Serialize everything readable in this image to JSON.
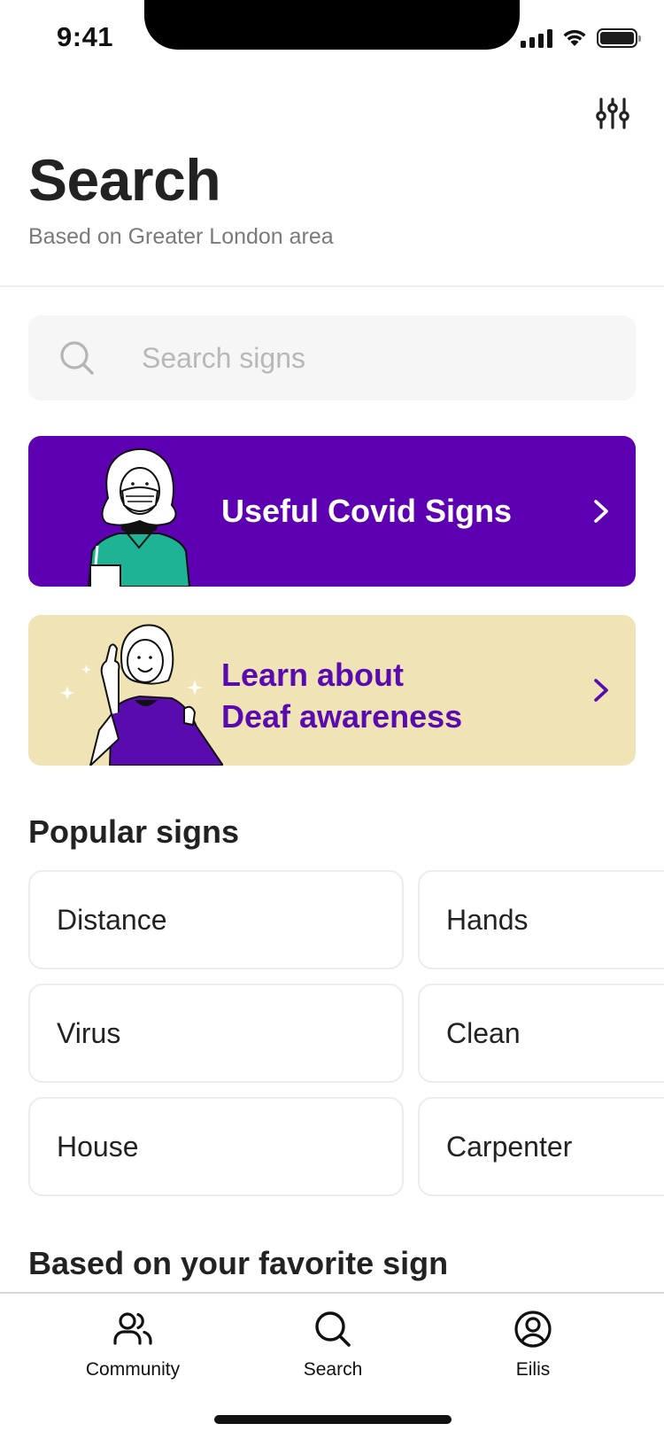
{
  "status_bar": {
    "time": "9:41"
  },
  "header": {
    "title": "Search",
    "subtitle": "Based on Greater London area",
    "filter_icon": "sliders-icon"
  },
  "search": {
    "placeholder": "Search signs",
    "value": ""
  },
  "banners": [
    {
      "label": "Useful Covid Signs",
      "background": "#5C00B2",
      "text_color": "#FFFFFF"
    },
    {
      "label_line1": "Learn about",
      "label_line2": "Deaf awareness",
      "background": "#F0E4B6",
      "text_color": "#5A0BB0"
    }
  ],
  "popular_signs": {
    "title": "Popular signs",
    "items": [
      "Distance",
      "Hands",
      "Virus",
      "Clean",
      "House",
      "Carpenter"
    ]
  },
  "favorite_section": {
    "title": "Based on your favorite sign"
  },
  "tabbar": {
    "tabs": [
      {
        "label": "Community",
        "icon": "people-icon"
      },
      {
        "label": "Search",
        "icon": "search-icon"
      },
      {
        "label": "Eilis",
        "icon": "profile-icon"
      }
    ]
  },
  "colors": {
    "brand_purple": "#5C00B2",
    "cream": "#F0E4B6",
    "teal": "#1DB394"
  }
}
